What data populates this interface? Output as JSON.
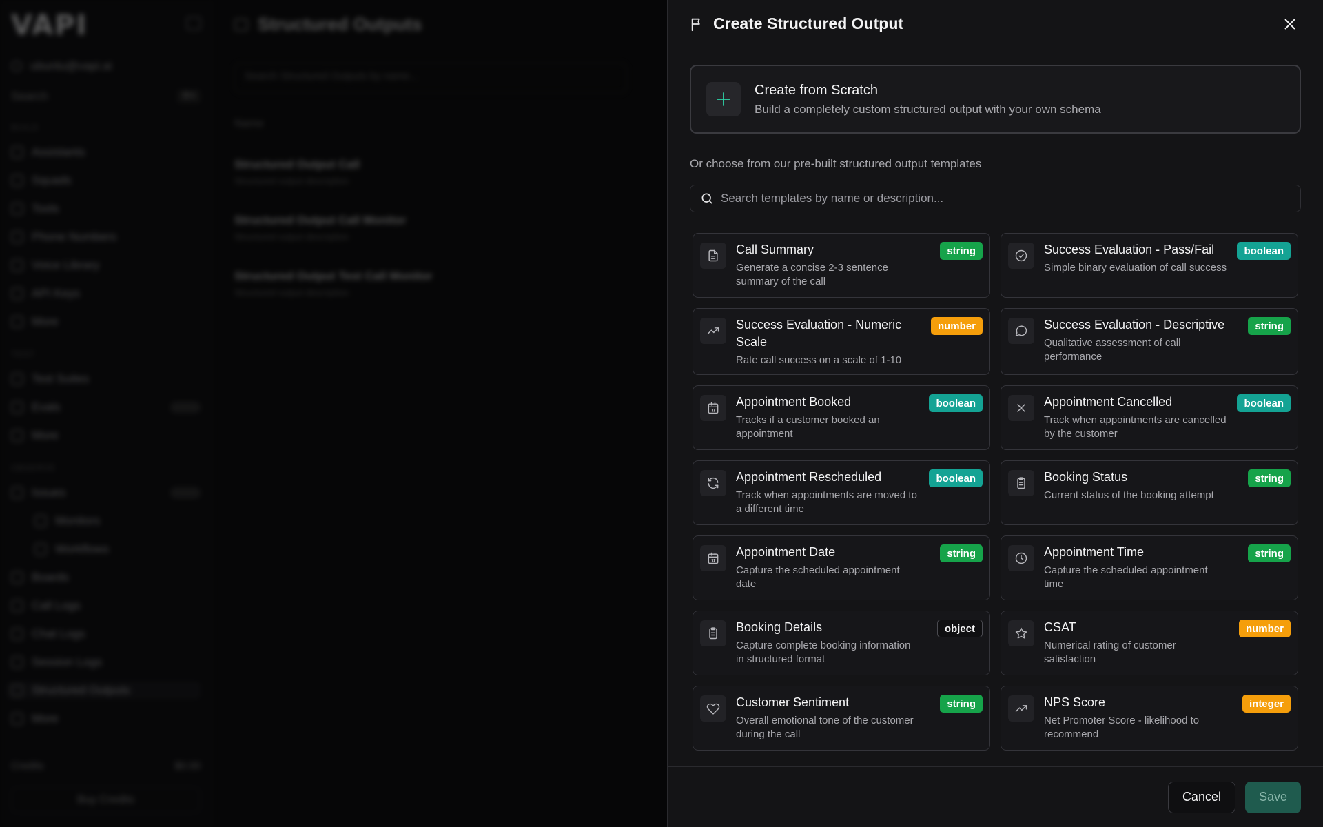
{
  "background": {
    "logo": "VAPI",
    "org": "ubuntu@vapi.ai",
    "search_label": "Search",
    "search_kbd": "⌘K",
    "sections": [
      {
        "title": "BUILD",
        "items": [
          "Assistants",
          "Squads",
          "Tools",
          "Phone Numbers",
          "Voice Library",
          "API Keys",
          "More"
        ]
      },
      {
        "title": "TEST",
        "items": [
          "Test Suites",
          "Evals",
          "More"
        ]
      },
      {
        "title": "OBSERVE",
        "items": [
          "Issues",
          "Monitors",
          "Workflows",
          "Boards",
          "Call Logs",
          "Chat Logs",
          "Session Logs",
          "Structured Outputs",
          "More"
        ]
      }
    ],
    "credits_label": "Credits",
    "credits_value": "$0.00",
    "buy_credits": "Buy Credits",
    "main_title": "Structured Outputs",
    "main_search_placeholder": "Search Structured Outputs by name...",
    "main_column": "Name",
    "main_rows": [
      {
        "title": "Structured Output Call",
        "desc": "Structured output description"
      },
      {
        "title": "Structured Output Call Monitor",
        "desc": "Structured output description"
      },
      {
        "title": "Structured Output Test Call Monitor",
        "desc": "Structured output description"
      }
    ]
  },
  "panel": {
    "title": "Create Structured Output",
    "scratch": {
      "title": "Create from Scratch",
      "desc": "Build a completely custom structured output with your own schema"
    },
    "or_text": "Or choose from our pre-built structured output templates",
    "search_placeholder": "Search templates by name or description...",
    "templates": [
      {
        "title": "Call Summary",
        "desc": "Generate a concise 2-3 sentence summary of the call",
        "type": "string",
        "icon": "file-text-icon"
      },
      {
        "title": "Success Evaluation - Pass/Fail",
        "desc": "Simple binary evaluation of call success",
        "type": "boolean",
        "icon": "check-circle-icon"
      },
      {
        "title": "Success Evaluation - Numeric Scale",
        "desc": "Rate call success on a scale of 1-10",
        "type": "number",
        "icon": "trending-up-icon"
      },
      {
        "title": "Success Evaluation - Descriptive",
        "desc": "Qualitative assessment of call performance",
        "type": "string",
        "icon": "message-circle-icon"
      },
      {
        "title": "Appointment Booked",
        "desc": "Tracks if a customer booked an appointment",
        "type": "boolean",
        "icon": "calendar-icon"
      },
      {
        "title": "Appointment Cancelled",
        "desc": "Track when appointments are cancelled by the customer",
        "type": "boolean",
        "icon": "x-icon"
      },
      {
        "title": "Appointment Rescheduled",
        "desc": "Track when appointments are moved to a different time",
        "type": "boolean",
        "icon": "refresh-icon"
      },
      {
        "title": "Booking Status",
        "desc": "Current status of the booking attempt",
        "type": "string",
        "icon": "clipboard-icon"
      },
      {
        "title": "Appointment Date",
        "desc": "Capture the scheduled appointment date",
        "type": "string",
        "icon": "calendar-icon"
      },
      {
        "title": "Appointment Time",
        "desc": "Capture the scheduled appointment time",
        "type": "string",
        "icon": "clock-icon"
      },
      {
        "title": "Booking Details",
        "desc": "Capture complete booking information in structured format",
        "type": "object",
        "icon": "clipboard-icon"
      },
      {
        "title": "CSAT",
        "desc": "Numerical rating of customer satisfaction",
        "type": "number",
        "icon": "star-icon"
      },
      {
        "title": "Customer Sentiment",
        "desc": "Overall emotional tone of the customer during the call",
        "type": "string",
        "icon": "heart-icon"
      },
      {
        "title": "NPS Score",
        "desc": "Net Promoter Score - likelihood to recommend",
        "type": "integer",
        "icon": "trending-up-icon"
      }
    ],
    "cancel_label": "Cancel",
    "save_label": "Save"
  },
  "colors": {
    "string": "#16a34a",
    "boolean": "#14a394",
    "number": "#f59e0b",
    "integer": "#f59e0b",
    "object": "#0f0f11"
  }
}
